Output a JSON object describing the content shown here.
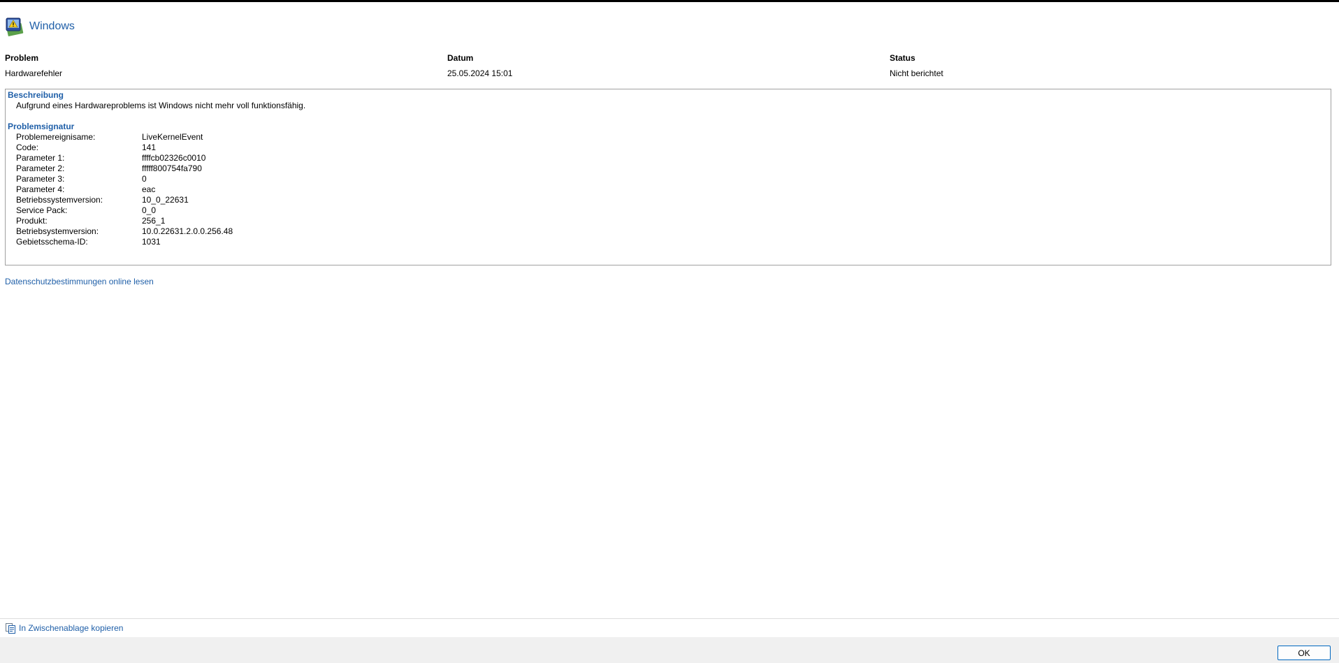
{
  "header": {
    "title": "Windows",
    "icon": "windows-action-center-icon"
  },
  "columns": {
    "problem_label": "Problem",
    "date_label": "Datum",
    "status_label": "Status",
    "problem_value": "Hardwarefehler",
    "date_value": "25.05.2024 15:01",
    "status_value": "Nicht berichtet"
  },
  "description": {
    "title": "Beschreibung",
    "text": "Aufgrund eines Hardwareproblems ist Windows nicht mehr voll funktionsfähig."
  },
  "signature": {
    "title": "Problemsignatur",
    "rows": [
      {
        "key": "Problemereignisame:",
        "value": "LiveKernelEvent"
      },
      {
        "key": "Code:",
        "value": "141"
      },
      {
        "key": "Parameter 1:",
        "value": "ffffcb02326c0010"
      },
      {
        "key": "Parameter 2:",
        "value": "fffff800754fa790"
      },
      {
        "key": "Parameter 3:",
        "value": "0"
      },
      {
        "key": "Parameter 4:",
        "value": "eac"
      },
      {
        "key": "Betriebssystemversion:",
        "value": "10_0_22631"
      },
      {
        "key": "Service Pack:",
        "value": "0_0"
      },
      {
        "key": "Produkt:",
        "value": "256_1"
      },
      {
        "key": "Betriebsystemversion:",
        "value": "10.0.22631.2.0.0.256.48"
      },
      {
        "key": "Gebietsschema-ID:",
        "value": "1031"
      }
    ]
  },
  "links": {
    "privacy": "Datenschutzbestimmungen online lesen",
    "copy": "In Zwischenablage kopieren"
  },
  "footer": {
    "ok_label": "OK"
  },
  "colors": {
    "link": "#1f5fa8",
    "button_border": "#0067c0",
    "footer_bg": "#f0f0f0"
  }
}
